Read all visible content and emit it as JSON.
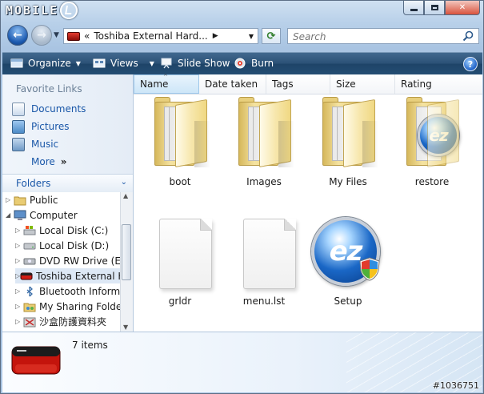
{
  "window": {
    "logo_text": "MOBILE",
    "colors": {
      "toolbar": "#2c5277",
      "selection": "#dde8f5",
      "link": "#1a57a8"
    }
  },
  "address": {
    "crumb_prefix": "«",
    "crumb": "Toshiba External Hard...",
    "search_placeholder": "Search"
  },
  "toolbar": {
    "organize": "Organize",
    "views": "Views",
    "slideshow": "Slide Show",
    "burn": "Burn",
    "help": "?"
  },
  "nav": {
    "favorite_heading": "Favorite Links",
    "favorites": [
      {
        "label": "Documents",
        "icon": "documents-icon"
      },
      {
        "label": "Pictures",
        "icon": "pictures-icon"
      },
      {
        "label": "Music",
        "icon": "music-icon"
      }
    ],
    "more": "More",
    "more_glyph": "»",
    "folders_heading": "Folders",
    "tree": [
      {
        "label": "Public",
        "icon": "folder-icon"
      },
      {
        "label": "Computer",
        "icon": "computer-icon"
      },
      {
        "label": "Local Disk (C:)",
        "icon": "system-drive-icon"
      },
      {
        "label": "Local Disk (D:)",
        "icon": "drive-icon"
      },
      {
        "label": "DVD RW Drive (E:)",
        "icon": "dvd-drive-icon"
      },
      {
        "label": "Toshiba External H",
        "icon": "external-drive-icon"
      },
      {
        "label": "Bluetooth Informa",
        "icon": "bluetooth-icon"
      },
      {
        "label": "My Sharing Folder",
        "icon": "sharing-folder-icon"
      },
      {
        "label": "沙盒防護資料夾",
        "icon": "sandbox-folder-icon"
      }
    ]
  },
  "columns": [
    "Name",
    "Date taken",
    "Tags",
    "Size",
    "Rating"
  ],
  "items": [
    {
      "name": "boot",
      "type": "folder"
    },
    {
      "name": "Images",
      "type": "folder"
    },
    {
      "name": "My Files",
      "type": "folder"
    },
    {
      "name": "restore",
      "type": "folder-ez"
    },
    {
      "name": "grldr",
      "type": "file"
    },
    {
      "name": "menu.lst",
      "type": "file"
    },
    {
      "name": "Setup",
      "type": "application"
    }
  ],
  "details": {
    "count": "7 items",
    "watermark": "#1036751"
  }
}
